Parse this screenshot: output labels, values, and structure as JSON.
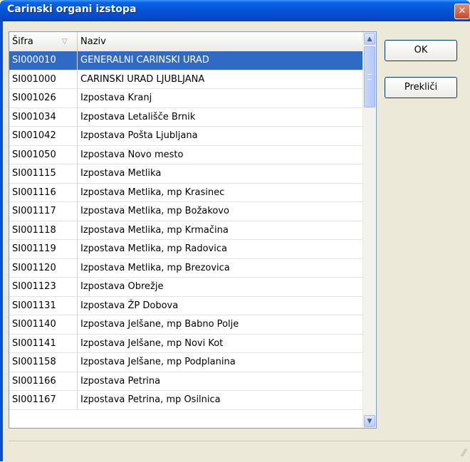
{
  "window": {
    "title": "Carinski organi izstopa",
    "close_glyph": "✕"
  },
  "table": {
    "columns": [
      "Šifra",
      "Naziv"
    ],
    "selected_row": 0,
    "rows": [
      [
        "SI000010",
        "GENERALNI CARINSKI URAD"
      ],
      [
        "SI001000",
        "CARINSKI URAD LJUBLJANA"
      ],
      [
        "SI001026",
        "Izpostava Kranj"
      ],
      [
        "SI001034",
        "Izpostava Letališče Brnik"
      ],
      [
        "SI001042",
        "Izpostava Pošta Ljubljana"
      ],
      [
        "SI001050",
        "Izpostava Novo mesto"
      ],
      [
        "SI001115",
        "Izpostava Metlika"
      ],
      [
        "SI001116",
        "Izpostava Metlika, mp Krasinec"
      ],
      [
        "SI001117",
        "Izpostava Metlika, mp Božakovo"
      ],
      [
        "SI001118",
        "Izpostava Metlika, mp Krmačina"
      ],
      [
        "SI001119",
        "Izpostava Metlika, mp Radovica"
      ],
      [
        "SI001120",
        "Izpostava Metlika, mp Brezovica"
      ],
      [
        "SI001123",
        "Izpostava Obrežje"
      ],
      [
        "SI001131",
        "Izpostava ŽP Dobova"
      ],
      [
        "SI001140",
        "Izpostava Jelšane, mp Babno Polje"
      ],
      [
        "SI001141",
        "Izpostava Jelšane, mp Novi Kot"
      ],
      [
        "SI001158",
        "Izpostava Jelšane, mp Podplanina"
      ],
      [
        "SI001166",
        "Izpostava Petrina"
      ],
      [
        "SI001167",
        "Izpostava Petrina, mp Osilnica"
      ]
    ]
  },
  "buttons": {
    "ok": "OK",
    "cancel": "Prekliči"
  },
  "colors": {
    "titlebar": "#0553d6",
    "selection": "#316ac5",
    "dialog_bg": "#ece9d8"
  }
}
